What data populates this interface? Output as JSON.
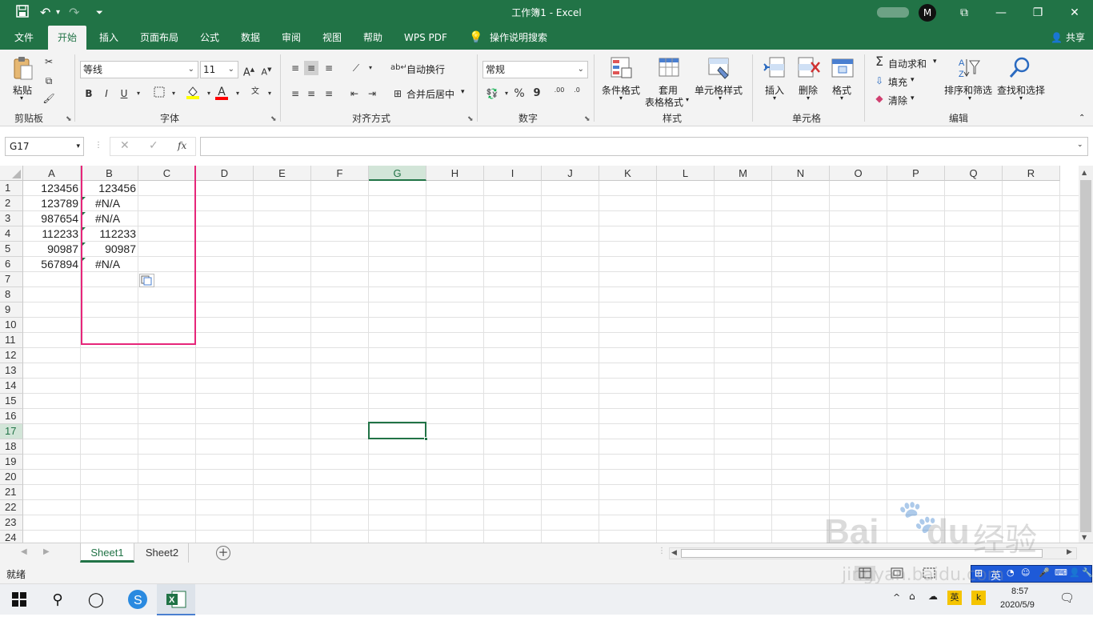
{
  "window": {
    "title": "工作簿1 - Excel",
    "controls": {
      "ribbon_opts": "⧉",
      "minimize": "—",
      "maximize": "❐",
      "close": "✕"
    },
    "user_initial": "M"
  },
  "menu_tabs": [
    "文件",
    "开始",
    "插入",
    "页面布局",
    "公式",
    "数据",
    "审阅",
    "视图",
    "帮助",
    "WPS PDF",
    "操作说明搜索"
  ],
  "active_tab": "开始",
  "share_label": "共享",
  "ribbon": {
    "clipboard": {
      "paste": "粘贴",
      "group": "剪贴板"
    },
    "font": {
      "name": "等线",
      "size": "11",
      "bold": "B",
      "italic": "I",
      "underline": "U",
      "color_letter": "A",
      "grow": "A",
      "shrink": "A",
      "group": "字体"
    },
    "alignment": {
      "wrap": "自动换行",
      "merge": "合并后居中",
      "group": "对齐方式"
    },
    "number": {
      "format": "常规",
      "percent": "%",
      "comma": "9",
      "inc": ".00",
      "dec": ".0",
      "group": "数字"
    },
    "styles": {
      "cond": "条件格式",
      "table_l1": "套用",
      "table_l2": "表格格式",
      "cell": "单元格样式",
      "group": "样式"
    },
    "cells": {
      "insert": "插入",
      "delete": "删除",
      "format": "格式",
      "group": "单元格"
    },
    "editing": {
      "autosum": "自动求和",
      "fill": "填充",
      "clear": "清除",
      "sort": "排序和筛选",
      "find": "查找和选择",
      "group": "编辑"
    }
  },
  "formula_bar": {
    "name_box": "G17",
    "fx": "fx",
    "formula": ""
  },
  "columns": [
    "A",
    "B",
    "C",
    "D",
    "E",
    "F",
    "G",
    "H",
    "I",
    "J",
    "K",
    "L",
    "M",
    "N",
    "O",
    "P",
    "Q",
    "R"
  ],
  "rows": [
    "1",
    "2",
    "3",
    "4",
    "5",
    "6",
    "7",
    "8",
    "9",
    "10",
    "11",
    "12",
    "13",
    "14",
    "15",
    "16",
    "17",
    "18",
    "19",
    "20",
    "21",
    "22",
    "23",
    "24"
  ],
  "cells": {
    "A": [
      "123456",
      "123789",
      "987654",
      "112233",
      "90987",
      "567894"
    ],
    "B": [
      "123456",
      "#N/A",
      "#N/A",
      "112233",
      "90987",
      "#N/A"
    ]
  },
  "selected_cell": {
    "column": "G",
    "row": "17"
  },
  "sheets": [
    "Sheet1",
    "Sheet2"
  ],
  "active_sheet": "Sheet1",
  "status": {
    "ready": "就绪"
  },
  "watermark": {
    "brand": "Bai",
    "brand2": "du",
    "cn": "经验",
    "url": "jingyan.baidu.com"
  },
  "ime": {
    "label": "英"
  },
  "taskbar": {
    "time": "8:57",
    "date": "2020/5/9",
    "lang": "英"
  },
  "colors": {
    "excel_green": "#217346",
    "highlight_box": "#e6267a"
  }
}
